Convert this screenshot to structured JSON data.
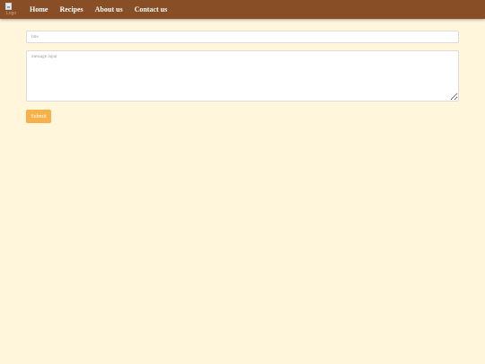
{
  "nav": {
    "logo_alt": "Logo",
    "links": [
      "Home",
      "Recipes",
      "About us",
      "Contact us"
    ]
  },
  "form": {
    "title_placeholder": "title",
    "title_value": "",
    "message_placeholder": "message input",
    "message_value": "",
    "submit_label": "Submit"
  },
  "colors": {
    "navbar": "#884e26",
    "background": "#fff6dc",
    "submit": "#f6b14a"
  }
}
